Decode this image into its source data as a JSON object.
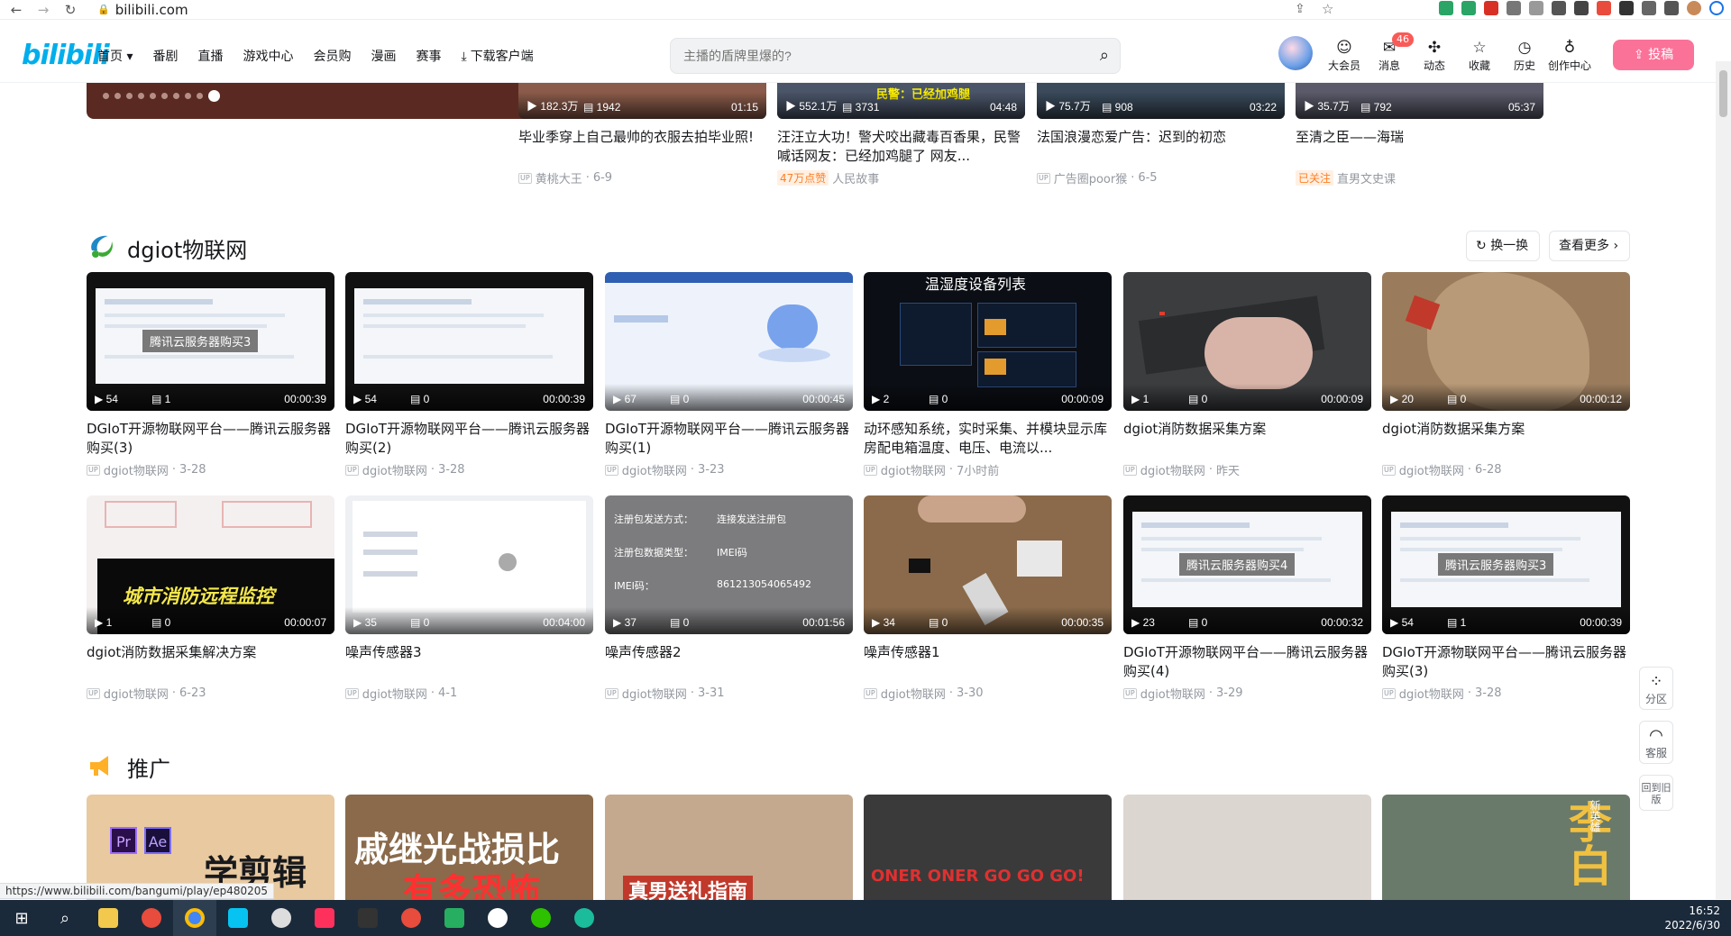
{
  "browser": {
    "url": "bilibili.com",
    "status_url": "https://www.bilibili.com/bangumi/play/ep480205"
  },
  "header": {
    "logo": "bilibili",
    "nav": [
      "首页",
      "番剧",
      "直播",
      "游戏中心",
      "会员购",
      "漫画",
      "赛事",
      "下载客户端"
    ],
    "search_placeholder": "主播的盾牌里爆的?",
    "actions": [
      {
        "label": "大会员",
        "icon": "vip-icon"
      },
      {
        "label": "消息",
        "icon": "message-icon",
        "badge": "46"
      },
      {
        "label": "动态",
        "icon": "dynamic-icon"
      },
      {
        "label": "收藏",
        "icon": "star-icon"
      },
      {
        "label": "历史",
        "icon": "history-icon"
      },
      {
        "label": "创作中心",
        "icon": "creator-icon"
      }
    ],
    "upload_label": "投稿"
  },
  "top_row": [
    {
      "plays": "182.3万",
      "danmu": "1942",
      "duration": "01:15",
      "title": "毕业季穿上自己最帅的衣服去拍毕业照!",
      "author": "黄桃大王",
      "date": "6-9",
      "thumb_color": "#8a5a4a"
    },
    {
      "plays": "552.1万",
      "danmu": "3731",
      "duration": "04:48",
      "title": "汪汪立大功！警犬咬出藏毒百香果，民警喊话网友：已经加鸡腿了 网友...",
      "tag": "47万点赞",
      "author": "人民故事",
      "date": "",
      "thumb_color": "#4a5568",
      "overlay": "民警：已经加鸡腿"
    },
    {
      "plays": "75.7万",
      "danmu": "908",
      "duration": "03:22",
      "title": "法国浪漫恋爱广告：迟到的初恋",
      "author": "广告圈poor猴",
      "date": "6-5",
      "thumb_color": "#3a4a5a"
    },
    {
      "plays": "35.7万",
      "danmu": "792",
      "duration": "05:37",
      "title": "至清之臣——海瑞",
      "tag": "已关注",
      "author": "直男文史课",
      "date": "",
      "thumb_color": "#5a5a6a"
    }
  ],
  "section_dgiot": {
    "title": "dgiot物联网",
    "refresh_label": "换一换",
    "more_label": "查看更多",
    "row1": [
      {
        "plays": "54",
        "danmu": "1",
        "duration": "00:00:39",
        "title": "DGIoT开源物联网平台——腾讯云服务器购买(3)",
        "author": "dgiot物联网",
        "date": "3-28",
        "overlay": "腾讯云服务器购买3",
        "style": "screen"
      },
      {
        "plays": "54",
        "danmu": "0",
        "duration": "00:00:39",
        "title": "DGIoT开源物联网平台——腾讯云服务器购买(2)",
        "author": "dgiot物联网",
        "date": "3-28",
        "overlay": "",
        "style": "screen"
      },
      {
        "plays": "67",
        "danmu": "0",
        "duration": "00:00:45",
        "title": "DGIoT开源物联网平台——腾讯云服务器购买(1)",
        "author": "dgiot物联网",
        "date": "3-23",
        "overlay": "",
        "style": "cloud"
      },
      {
        "plays": "2",
        "danmu": "0",
        "duration": "00:00:09",
        "title": "动环感知系统，实时采集、并模块显示库房配电箱温度、电压、电流以...",
        "author": "dgiot物联网",
        "date": "7小时前",
        "overlay": "温湿度设备列表",
        "style": "dark"
      },
      {
        "plays": "1",
        "danmu": "0",
        "duration": "00:00:09",
        "title": "dgiot消防数据采集方案",
        "author": "dgiot物联网",
        "date": "昨天",
        "overlay": "",
        "style": "hand"
      },
      {
        "plays": "20",
        "danmu": "0",
        "duration": "00:00:12",
        "title": "dgiot消防数据采集方案",
        "author": "dgiot物联网",
        "date": "6-28",
        "overlay": "",
        "style": "stone"
      }
    ],
    "row2": [
      {
        "plays": "1",
        "danmu": "0",
        "duration": "00:00:07",
        "title": "dgiot消防数据采集解决方案",
        "author": "dgiot物联网",
        "date": "6-23",
        "overlay": "城市消防远程监控",
        "style": "fire"
      },
      {
        "plays": "35",
        "danmu": "0",
        "duration": "00:04:00",
        "title": "噪声传感器3",
        "author": "dgiot物联网",
        "date": "4-1",
        "overlay": "",
        "style": "form"
      },
      {
        "plays": "37",
        "danmu": "0",
        "duration": "00:01:56",
        "title": "噪声传感器2",
        "author": "dgiot物联网",
        "date": "3-31",
        "overlay": "",
        "style": "settings",
        "rows": [
          "注册包发送方式：",
          "连接发送注册包",
          "注册包数据类型：",
          "IMEI码",
          "IMEI码：",
          "861213054065492"
        ]
      },
      {
        "plays": "34",
        "danmu": "0",
        "duration": "00:00:35",
        "title": "噪声传感器1",
        "author": "dgiot物联网",
        "date": "3-30",
        "overlay": "",
        "style": "desk"
      },
      {
        "plays": "23",
        "danmu": "0",
        "duration": "00:00:32",
        "title": "DGIoT开源物联网平台——腾讯云服务器购买(4)",
        "author": "dgiot物联网",
        "date": "3-29",
        "overlay": "腾讯云服务器购买4",
        "style": "screen"
      },
      {
        "plays": "54",
        "danmu": "1",
        "duration": "00:00:39",
        "title": "DGIoT开源物联网平台——腾讯云服务器购买(3)",
        "author": "dgiot物联网",
        "date": "3-28",
        "overlay": "腾讯云服务器购买3",
        "style": "screen"
      }
    ]
  },
  "section_promo": {
    "title": "推广",
    "thumbs": [
      {
        "overlay": "学剪辑",
        "color": "#e8c9a0"
      },
      {
        "overlay": "戚继光战损比",
        "overlay2": "有多恐怖",
        "color": "#8a6a4a"
      },
      {
        "overlay": "真男送礼指南",
        "color": "#c4a98f"
      },
      {
        "overlay": "ONER ONER GO GO GO!",
        "color": "#3a3a3a"
      },
      {
        "overlay": "",
        "color": "#dcd6d0"
      },
      {
        "overlay": "李白",
        "overlay2": "新英雄",
        "color": "#6a7a6a"
      }
    ]
  },
  "side_tools": [
    {
      "label": "分区",
      "icon": "grid-icon"
    },
    {
      "label": "客服",
      "icon": "headset-icon"
    },
    {
      "label": "回到旧版",
      "icon": ""
    }
  ],
  "taskbar": {
    "time": "16:52",
    "date": "2022/6/30"
  }
}
